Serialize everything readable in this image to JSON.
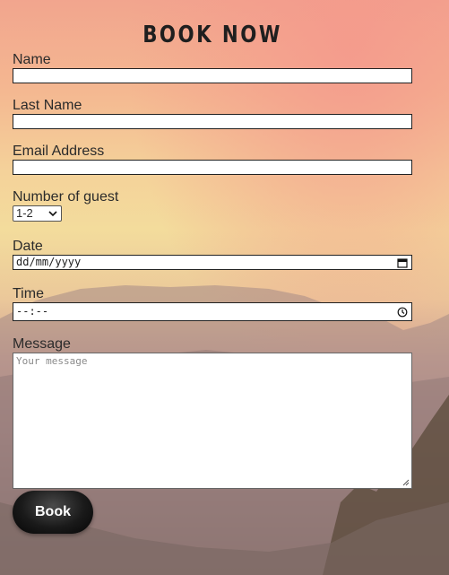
{
  "form": {
    "title": "BOOK NOW",
    "name_label": "Name",
    "name_value": "",
    "last_name_label": "Last Name",
    "last_name_value": "",
    "email_label": "Email Address",
    "email_value": "",
    "guests_label": "Number of guest",
    "guests_selected": "1-2",
    "date_label": "Date",
    "date_placeholder": "dd/mm/yyyy",
    "time_label": "Time",
    "time_placeholder": "--:--",
    "message_label": "Message",
    "message_placeholder": "Your message",
    "submit_label": "Book"
  },
  "icons": {
    "guests_dropdown": "chevron-down-icon",
    "date_picker": "calendar-icon",
    "time_picker": "clock-icon",
    "textarea_resize": "resize-handle-icon"
  },
  "colors": {
    "button_bg": "#111111",
    "button_text": "#ffffff",
    "field_border": "#222222",
    "label_text": "#2b2b2b"
  }
}
